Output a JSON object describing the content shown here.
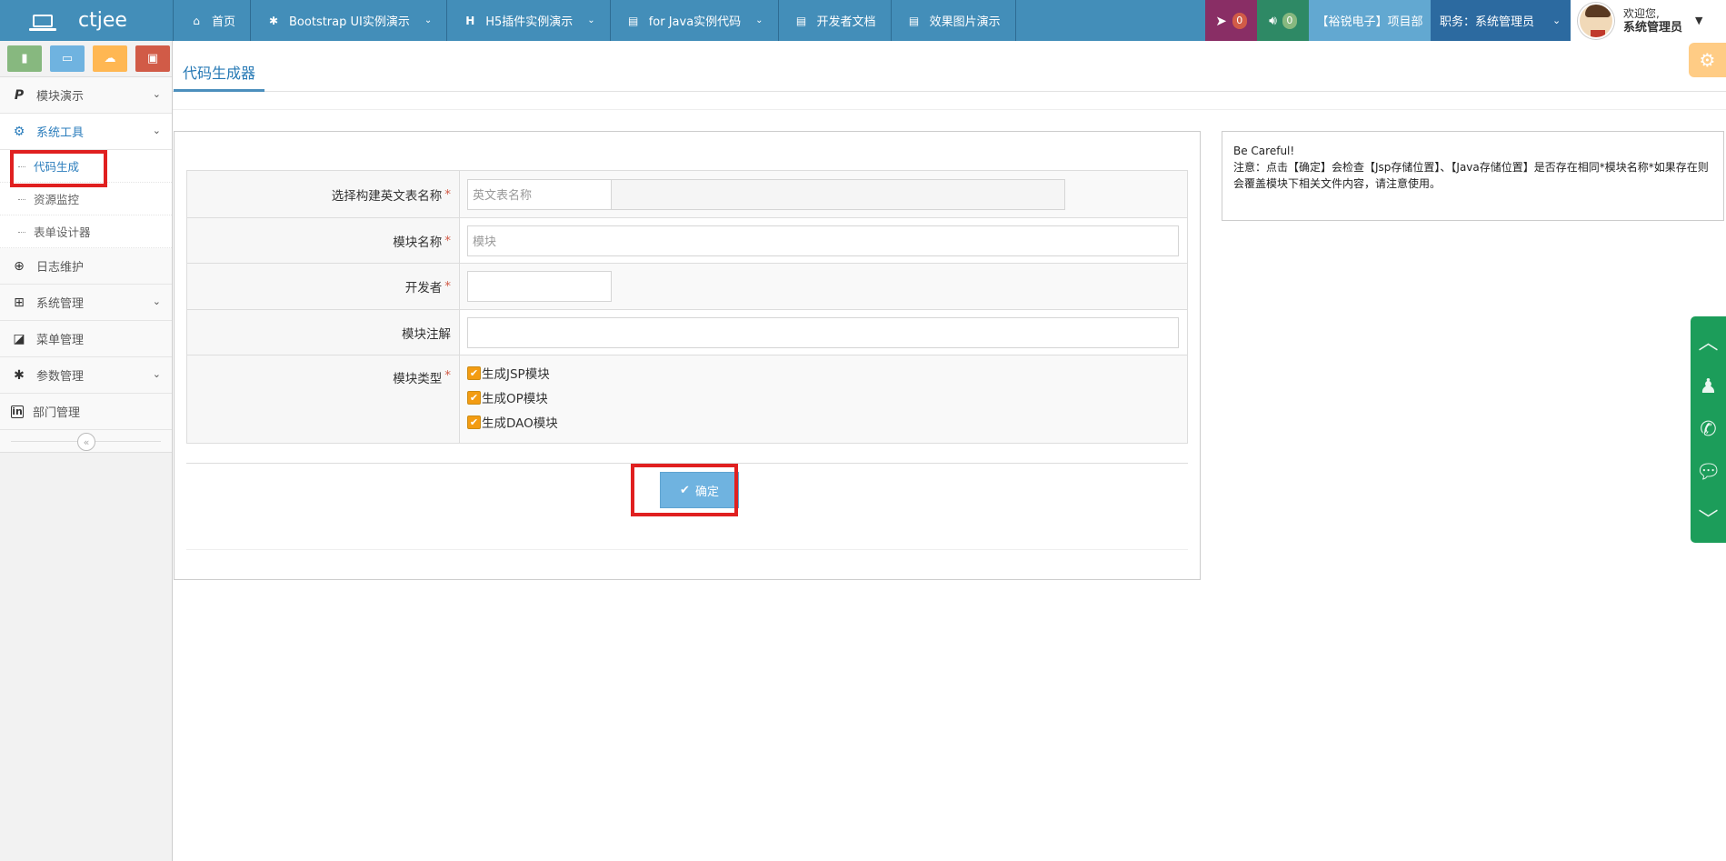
{
  "navbar": {
    "brand": "ctjee",
    "items": [
      {
        "label": "首页",
        "icon": "home-icon",
        "has_dropdown": false
      },
      {
        "label": "Bootstrap UI实例演示",
        "icon": "puzzle-icon",
        "has_dropdown": true
      },
      {
        "label": "H5插件实例演示",
        "icon": "html5-icon",
        "has_dropdown": true
      },
      {
        "label": "for Java实例代码",
        "icon": "file-code-icon",
        "has_dropdown": true
      },
      {
        "label": "开发者文档",
        "icon": "file-text-icon",
        "has_dropdown": false
      },
      {
        "label": "效果图片演示",
        "icon": "file-image-icon",
        "has_dropdown": false
      }
    ],
    "notifications": {
      "tasks_count": "0",
      "messages_count": "0"
    },
    "project": "【裕锐电子】项目部",
    "role": "职务：系统管理员",
    "user": {
      "greeting": "欢迎您,",
      "name": "系统管理员"
    }
  },
  "sidebar": {
    "shortcuts": [
      {
        "icon": "signal-icon",
        "color": "#87b87f"
      },
      {
        "icon": "pencil-icon",
        "color": "#6fb3e0"
      },
      {
        "icon": "users-icon",
        "color": "#ffb752"
      },
      {
        "icon": "cogs-icon",
        "color": "#d15b47"
      }
    ],
    "menu": [
      {
        "label": "模块演示",
        "icon": "paypal-icon",
        "has_children": true
      },
      {
        "label": "系统工具",
        "icon": "gear-icon",
        "has_children": true,
        "open": true,
        "children": [
          {
            "label": "代码生成",
            "active": true
          },
          {
            "label": "资源监控"
          },
          {
            "label": "表单设计器"
          }
        ]
      },
      {
        "label": "日志维护",
        "icon": "search-plus-icon",
        "has_children": false
      },
      {
        "label": "系统管理",
        "icon": "windows-icon",
        "has_children": true
      },
      {
        "label": "菜单管理",
        "icon": "share-square-icon",
        "has_children": false
      },
      {
        "label": "参数管理",
        "icon": "asterisk-icon",
        "has_children": true
      },
      {
        "label": "部门管理",
        "icon": "linkedin-icon",
        "has_children": false
      }
    ],
    "collapse_glyph": "«"
  },
  "page": {
    "tab_title": "代码生成器"
  },
  "form": {
    "fields": [
      {
        "label": "选择构建英文表名称",
        "required": true,
        "placeholder": "英文表名称",
        "value": ""
      },
      {
        "label": "模块名称",
        "required": true,
        "placeholder": "模块",
        "value": ""
      },
      {
        "label": "开发者",
        "required": true,
        "placeholder": "",
        "value": ""
      },
      {
        "label": "模块注解",
        "required": false,
        "placeholder": "",
        "value": ""
      },
      {
        "label": "模块类型",
        "required": true
      }
    ],
    "module_types": [
      {
        "label": "生成JSP模块",
        "checked": true
      },
      {
        "label": "生成OP模块",
        "checked": true
      },
      {
        "label": "生成DAO模块",
        "checked": true
      }
    ],
    "submit_label": "确定"
  },
  "note": {
    "title": "Be Careful!",
    "text": "注意：点击【确定】会检查【Jsp存储位置】、【Java存储位置】是否存在相同*模块名称*如果存在则会覆盖模块下相关文件内容，请注意使用。"
  },
  "colors": {
    "navbar": "#438eb9",
    "accent": "#2b7dbc",
    "highlight_box": "#e02020",
    "checkbox": "#f39c12",
    "widget": "#1c9d5a"
  }
}
